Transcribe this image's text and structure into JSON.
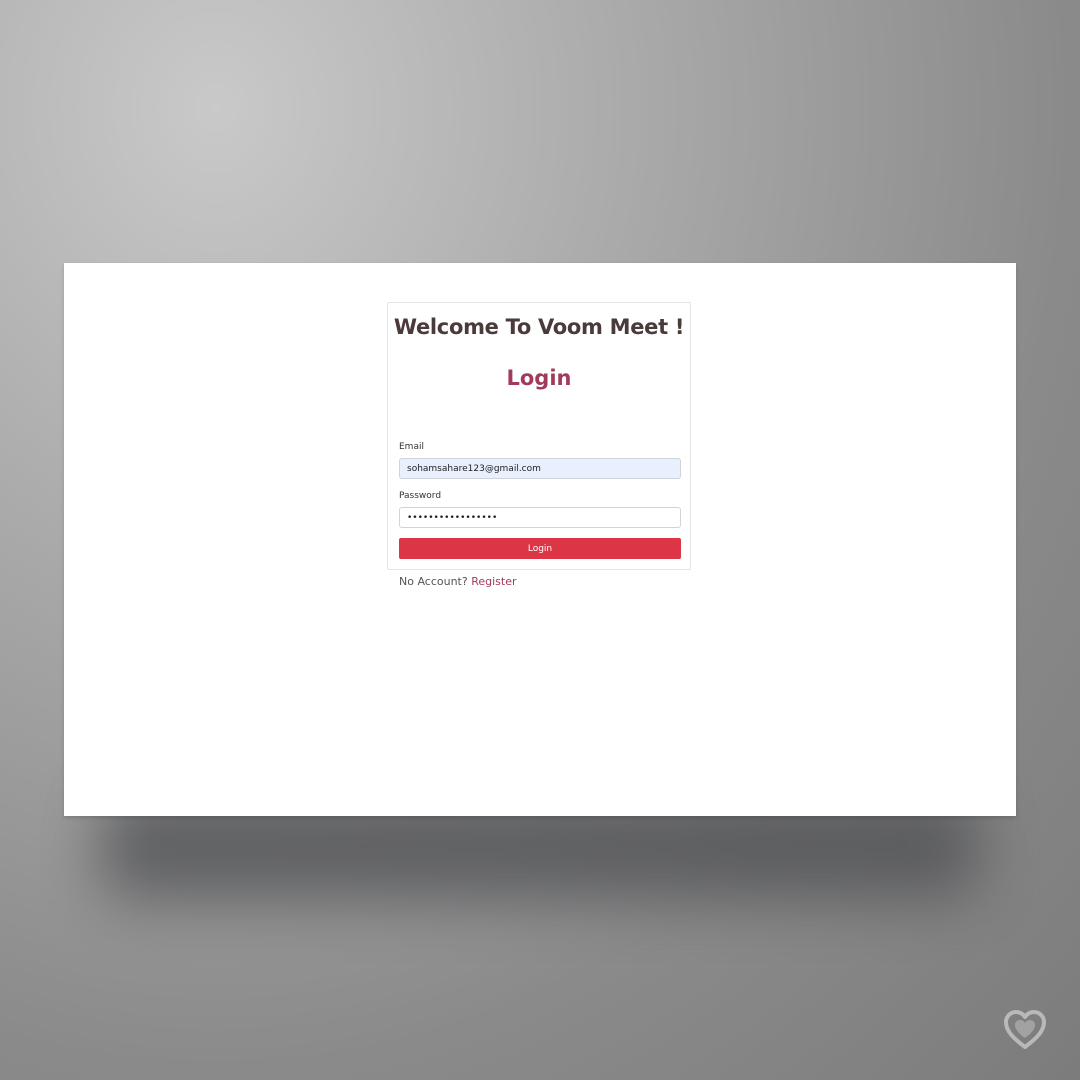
{
  "app": {
    "welcome_title": "Welcome To Voom Meet !",
    "login_title": "Login"
  },
  "form": {
    "email_label": "Email",
    "email_value": "sohamsahare123@gmail.com",
    "password_label": "Password",
    "password_value": "•••••••••••••••••",
    "submit_label": "Login"
  },
  "footer": {
    "prompt": "No Account?",
    "register_label": "Register"
  },
  "colors": {
    "accent": "#a23a5a",
    "button": "#dc3545",
    "autofill_bg": "#e8f0fe"
  },
  "icons": {
    "watermark": "heart-icon"
  }
}
